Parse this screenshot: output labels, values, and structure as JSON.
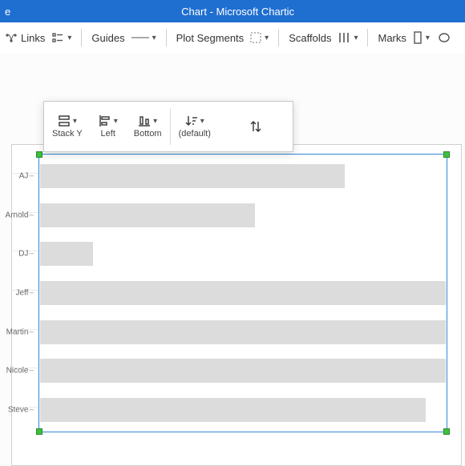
{
  "titlebar": {
    "left": "e",
    "center": "Chart - Microsoft Chartic"
  },
  "ribbon": {
    "links": {
      "label": "Links"
    },
    "guides": {
      "label": "Guides"
    },
    "plotSegments": {
      "label": "Plot Segments"
    },
    "scaffolds": {
      "label": "Scaffolds"
    },
    "marks": {
      "label": "Marks"
    }
  },
  "panel": {
    "stackY": {
      "label": "Stack Y"
    },
    "left": {
      "label": "Left"
    },
    "bottom": {
      "label": "Bottom"
    },
    "default": {
      "label": "(default)"
    }
  },
  "chart_data": {
    "type": "bar",
    "orientation": "horizontal",
    "categories": [
      "AJ",
      "Arnold",
      "DJ",
      "Jeff",
      "Martin",
      "Nicole",
      "Steve"
    ],
    "values": [
      75,
      53,
      13,
      100,
      100,
      100,
      95
    ],
    "xlim": [
      0,
      100
    ],
    "title": "",
    "xlabel": "",
    "ylabel": ""
  },
  "colors": {
    "accent": "#1f6fd0",
    "selection": "#2f88d6",
    "handle": "#3fbf3f",
    "bar": "#dcdcdc"
  }
}
